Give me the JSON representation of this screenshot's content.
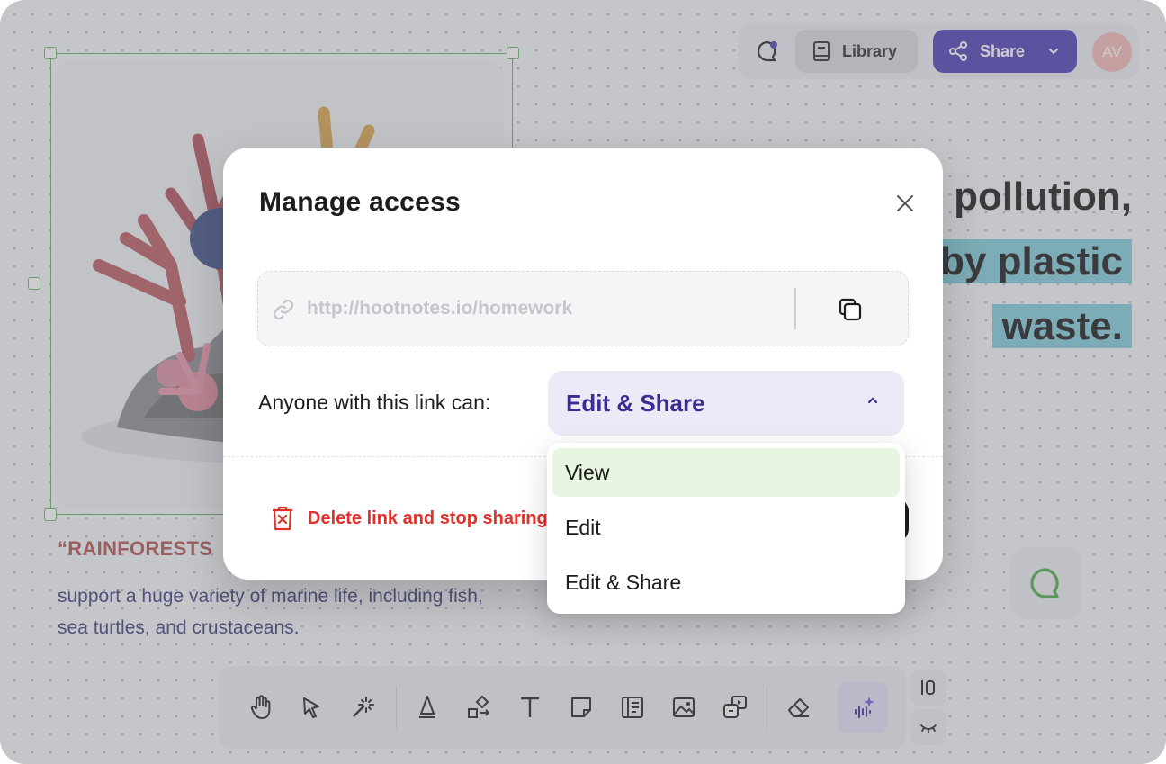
{
  "canvas": {
    "quote_title": "“RAINFORESTS",
    "quote_body": "support a huge variety of marine life, including fish, sea turtles, and crustaceans.",
    "headline": [
      "pollution,",
      "by plastic",
      "waste."
    ]
  },
  "top_bar": {
    "library_label": "Library",
    "share_label": "Share",
    "avatar_initials": "AV"
  },
  "modal": {
    "title": "Manage access",
    "link_url": "http://hootnotes.io/homework",
    "permission_label": "Anyone with this link can:",
    "permission_value": "Edit & Share",
    "delete_label": "Delete link and stop sharing"
  },
  "dropdown": {
    "options": [
      "View",
      "Edit",
      "Edit & Share"
    ],
    "highlighted": "View"
  },
  "colors": {
    "accent": "#4b3db4",
    "selection_green": "#5fb35c",
    "danger": "#e0312b",
    "highlight_teal": "#7ecbd8",
    "option_hover": "#e8f5e1"
  }
}
